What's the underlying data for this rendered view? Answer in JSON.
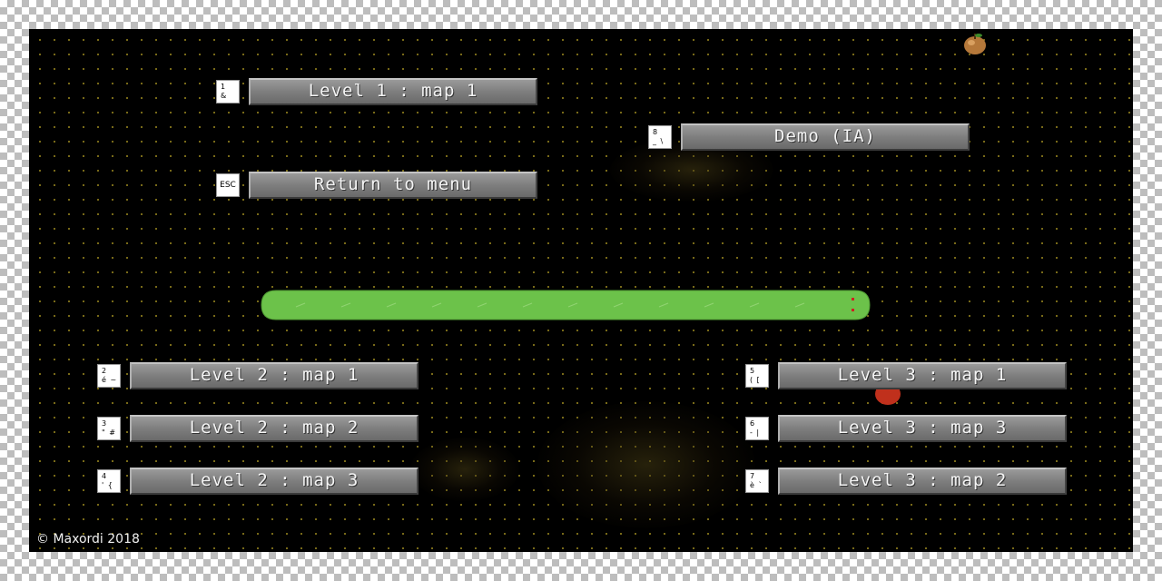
{
  "menu": {
    "buttons": [
      {
        "label": "Level 1 : map 1",
        "key_top": "1",
        "key_bottom": "&"
      },
      {
        "label": "Demo (IA)",
        "key_top": "8",
        "key_bottom": "_ \\"
      },
      {
        "label": "Return to menu",
        "key_top": "ESC",
        "key_bottom": ""
      },
      {
        "label": "Level 2 : map 1",
        "key_top": "2",
        "key_bottom": "é ~"
      },
      {
        "label": "Level 2 : map 2",
        "key_top": "3",
        "key_bottom": "\" #"
      },
      {
        "label": "Level 2 : map 3",
        "key_top": "4",
        "key_bottom": "' {"
      },
      {
        "label": "Level 3 : map 1",
        "key_top": "5",
        "key_bottom": "( ["
      },
      {
        "label": "Level 3 : map 3",
        "key_top": "6",
        "key_bottom": "- |"
      },
      {
        "label": "Level 3 : map 2",
        "key_top": "7",
        "key_bottom": "è `"
      }
    ]
  },
  "footer": {
    "copyright": "© Maxordi 2018"
  },
  "colors": {
    "snake_body": "#6cc24a",
    "snake_eyes": "#d02020",
    "button_face": "#7e7e7e",
    "board": "#000000"
  },
  "icons": {
    "top_fruit": "apple-icon",
    "side_fruit": "red-fruit-icon"
  }
}
